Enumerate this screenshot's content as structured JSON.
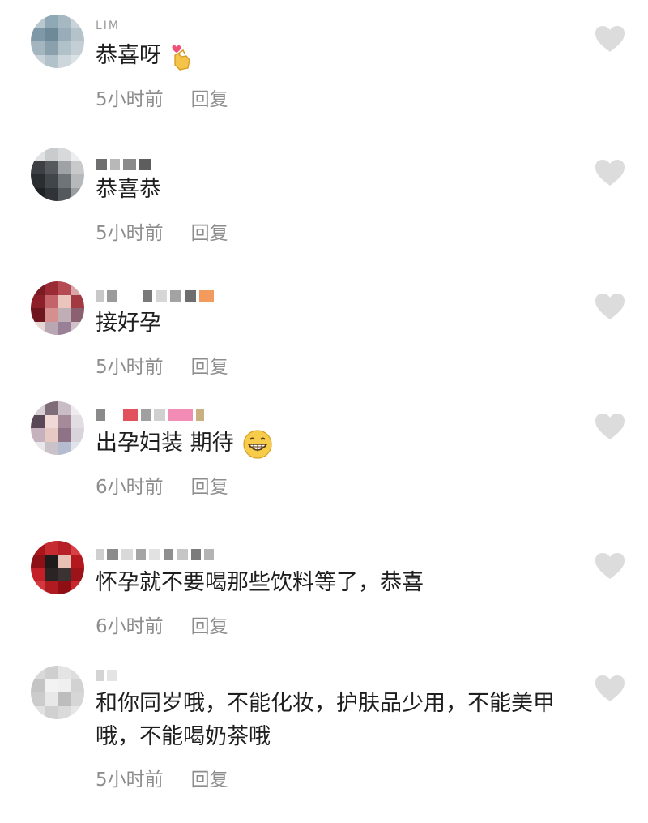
{
  "comments": [
    {
      "user": "LIM",
      "text": "恭喜呀",
      "emoji": "heart-hands",
      "time": "5小时前",
      "reply": "回复"
    },
    {
      "user": "",
      "text": "恭喜恭",
      "emoji": "",
      "time": "5小时前",
      "reply": "回复"
    },
    {
      "user": "",
      "text": "接好孕",
      "emoji": "",
      "time": "5小时前",
      "reply": "回复"
    },
    {
      "user": "",
      "text": "出孕妇装 期待",
      "emoji": "grin",
      "time": "6小时前",
      "reply": "回复"
    },
    {
      "user": "",
      "text": "怀孕就不要喝那些饮料等了，恭喜",
      "emoji": "",
      "time": "6小时前",
      "reply": "回复"
    },
    {
      "user": "",
      "text": "和你同岁哦，不能化妆，护肤品少用，不能美甲哦，不能喝奶茶哦",
      "emoji": "",
      "time": "5小时前",
      "reply": "回复"
    }
  ],
  "icons": {
    "like": "heart-outline-icon",
    "heart_color": "#dcdcdc"
  }
}
